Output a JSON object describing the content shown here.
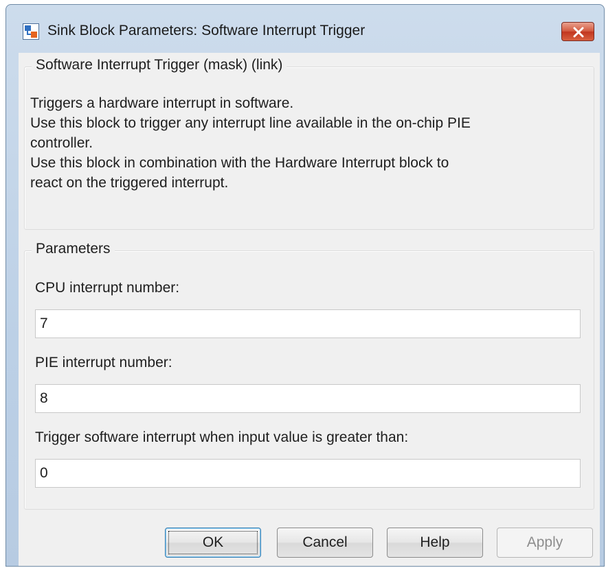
{
  "window": {
    "title": "Sink Block Parameters: Software Interrupt Trigger",
    "app_icon": "simulink-block-icon",
    "close_icon": "close-icon"
  },
  "description": {
    "group_title": "Software Interrupt Trigger (mask) (link)",
    "lines": [
      "Triggers a hardware interrupt in software.",
      "Use this block to trigger any interrupt line available in the on-chip PIE",
      "controller.",
      "Use this block in combination with the Hardware Interrupt block to",
      "react on the triggered interrupt."
    ]
  },
  "parameters": {
    "group_title": "Parameters",
    "fields": [
      {
        "label": "CPU interrupt number:",
        "value": "7"
      },
      {
        "label": "PIE interrupt number:",
        "value": "8"
      },
      {
        "label": "Trigger software interrupt when input value is greater than:",
        "value": "0"
      }
    ]
  },
  "buttons": {
    "ok": "OK",
    "cancel": "Cancel",
    "help": "Help",
    "apply": "Apply"
  },
  "colors": {
    "title_bar": "#bcd0e6",
    "close_button": "#c9402a",
    "dialog_background": "#f0f0f0",
    "default_button_border": "#3c7fb1"
  }
}
